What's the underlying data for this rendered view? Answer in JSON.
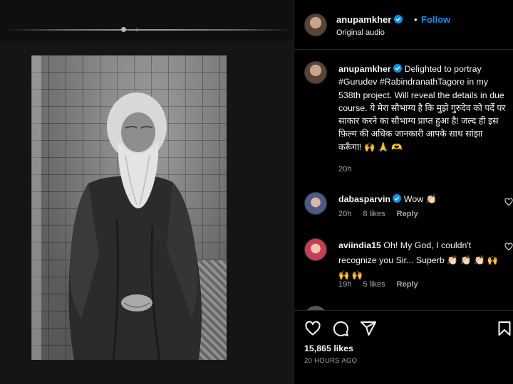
{
  "post": {
    "username": "anupamkher",
    "follow_label": "Follow",
    "separator": "•",
    "audio_label": "Original audio",
    "caption_text": "Delighted to portray #Gurudev #RabindranathTagore in my 538th project. Will reveal the details in due course. ये मेरा सौभाग्य है कि मुझे गुरुदेव को पर्दे पर साकार करने का सौभाग्य प्राप्त हुआ है! जल्द ही इस फ़िल्म की अधिक जानकारी आपके साथ सांझा करूँगा! 🙌 🙏 🫶",
    "caption_time": "20h",
    "likes": "15,865 likes",
    "posted_ago": "20 HOURS AGO"
  },
  "comments": [
    {
      "username": "dabasparvin",
      "verified": true,
      "text": "Wow 👏🏻",
      "time": "20h",
      "likes": "8 likes",
      "reply_label": "Reply"
    },
    {
      "username": "aviindia15",
      "verified": false,
      "text": "Oh! My God, I couldn't recognize you Sir... Superb 👏🏻 👏🏻 👏🏻 🙌 🙌 🙌",
      "time": "19h",
      "likes": "5 likes",
      "reply_label": "Reply"
    }
  ],
  "icons": {
    "verified": "verified-badge-icon",
    "like": "heart-icon",
    "comment": "comment-bubble-icon",
    "share": "paper-plane-icon",
    "save": "bookmark-icon"
  },
  "colors": {
    "background": "#000000",
    "accent": "#0095f6",
    "muted_text": "#a8a8a8",
    "divider": "#262626"
  }
}
